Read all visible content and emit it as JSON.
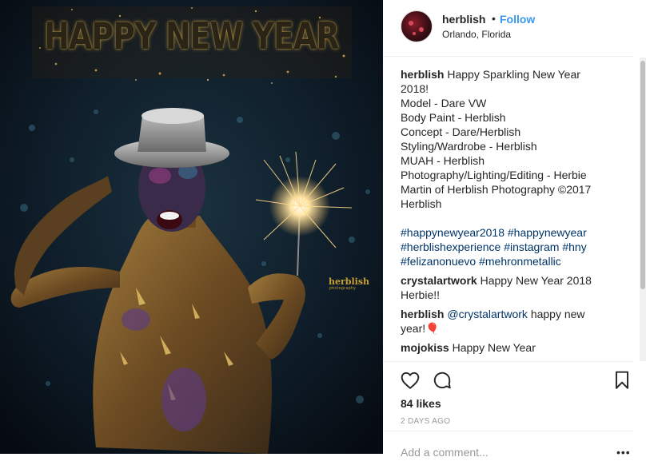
{
  "photo": {
    "banner_text": "HAPPY NEW YEAR",
    "watermark": "herblish",
    "watermark_sub": "photography"
  },
  "header": {
    "username": "herblish",
    "separator": "•",
    "follow_label": "Follow",
    "location": "Orlando, Florida",
    "follow_color": "#3897f0"
  },
  "caption": {
    "username": "herblish",
    "lines": [
      "Happy Sparkling New Year",
      "2018!",
      "Model - Dare VW",
      "Body Paint - Herblish",
      "Concept - Dare/Herblish",
      "Styling/Wardrobe - Herblish",
      "MUAH - Herblish",
      "Photography/Lighting/Editing - Herbie",
      "Martin of Herblish Photography ©2017",
      "Herblish"
    ],
    "hashtags": [
      [
        "#happynewyear2018",
        "#happynewyear"
      ],
      [
        "#herblishexperience",
        "#instagram",
        "#hny"
      ],
      [
        "#felizanonuevo",
        "#mehronmetallic"
      ]
    ]
  },
  "comments": [
    {
      "user": "crystalartwork",
      "text_lines": [
        "Happy New Year 2018",
        "Herbie!!"
      ]
    },
    {
      "user": "herblish",
      "mention": "@crystalartwork",
      "text_lines": [
        "happy new",
        "year!🎈"
      ]
    },
    {
      "user": "mojokiss",
      "text_lines": [
        "Happy New Year"
      ]
    }
  ],
  "actions": {
    "icons": [
      "heart-icon",
      "comment-icon",
      "bookmark-icon"
    ],
    "likes": "84 likes",
    "timestamp": "2 DAYS AGO",
    "add_comment_placeholder": "Add a comment...",
    "more_label": "•••"
  },
  "colors": {
    "tag": "#003569",
    "muted": "#999999",
    "text": "#262626"
  }
}
